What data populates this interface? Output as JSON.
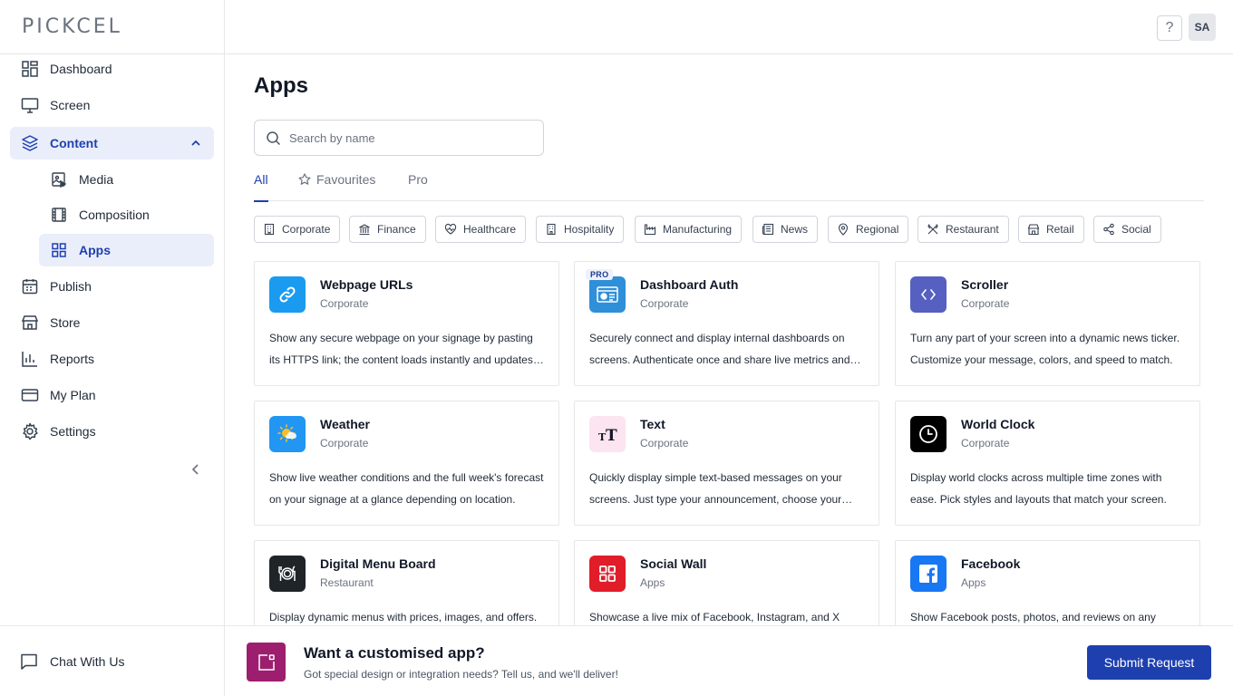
{
  "brand": {
    "logo_text": "PICKCEL"
  },
  "sidebar": {
    "items": [
      {
        "label": "Dashboard",
        "icon": "dashboard-icon"
      },
      {
        "label": "Screen",
        "icon": "monitor-icon"
      },
      {
        "label": "Content",
        "icon": "layers-icon",
        "expanded": true,
        "active": true
      },
      {
        "label": "Media",
        "icon": "image-icon",
        "sub": true
      },
      {
        "label": "Composition",
        "icon": "film-icon",
        "sub": true
      },
      {
        "label": "Apps",
        "icon": "grid-icon",
        "sub": true,
        "active": true
      },
      {
        "label": "Publish",
        "icon": "calendar-icon"
      },
      {
        "label": "Store",
        "icon": "store-icon"
      },
      {
        "label": "Reports",
        "icon": "bar-chart-icon"
      },
      {
        "label": "My Plan",
        "icon": "credit-card-icon"
      },
      {
        "label": "Settings",
        "icon": "gear-icon"
      }
    ],
    "chat_label": "Chat With Us"
  },
  "header": {
    "help_label": "?",
    "avatar_initials": "SA"
  },
  "main": {
    "title": "Apps",
    "search": {
      "placeholder": "Search by name",
      "value": ""
    },
    "tabs": [
      {
        "label": "All",
        "active": true
      },
      {
        "label": "Favourites",
        "icon": "star-icon"
      },
      {
        "label": "Pro"
      }
    ],
    "categories": [
      "Corporate",
      "Finance",
      "Healthcare",
      "Hospitality",
      "Manufacturing",
      "News",
      "Regional",
      "Restaurant",
      "Retail",
      "Social"
    ],
    "apps": [
      {
        "name": "Webpage URLs",
        "category": "Corporate",
        "description": "Show any secure webpage on your signage by pasting its HTTPS link; the content loads instantly and updates automatically.",
        "icon": "link-icon",
        "color": "#1a9bf0"
      },
      {
        "name": "Dashboard Auth",
        "category": "Corporate",
        "description": "Securely connect and display internal dashboards on screens. Authenticate once and share live metrics and reports.",
        "icon": "dashboard-auth-icon",
        "color": "#2f8fd8",
        "badge": "PRO"
      },
      {
        "name": "Scroller",
        "category": "Corporate",
        "description": "Turn any part of your screen into a dynamic news ticker. Customize your message, colors, and speed to match.",
        "icon": "code-brackets-icon",
        "color": "#5560c0"
      },
      {
        "name": "Weather",
        "category": "Corporate",
        "description": "Show live weather conditions and the full week's forecast on your signage at a glance depending on location.",
        "icon": "sun-cloud-icon",
        "color": "#2196f3"
      },
      {
        "name": "Text",
        "category": "Corporate",
        "description": "Quickly display simple text-based messages on your screens. Just type your announcement, choose your style.",
        "icon": "text-size-icon",
        "color": "#fce4f1"
      },
      {
        "name": "World Clock",
        "category": "Corporate",
        "description": "Display world clocks across multiple time zones with ease. Pick styles and layouts that match your screen.",
        "icon": "clock-icon",
        "color": "#000000"
      },
      {
        "name": "Digital Menu Board",
        "category": "Restaurant",
        "description": "Display dynamic menus with prices, images, and offers.",
        "icon": "plate-cutlery-icon",
        "color": "#1f2429"
      },
      {
        "name": "Social Wall",
        "category": "Apps",
        "description": "Showcase a live mix of Facebook, Instagram, and X posts.",
        "icon": "grid-apps-icon",
        "color": "#e11d2a"
      },
      {
        "name": "Facebook",
        "category": "Apps",
        "description": "Show Facebook posts, photos, and reviews on any screen.",
        "icon": "facebook-icon",
        "color": "#1877f2"
      }
    ]
  },
  "banner": {
    "title": "Want a customised app?",
    "subtitle": "Got special design or integration needs? Tell us, and we'll deliver!",
    "button_label": "Submit Request",
    "icon": "external-square-icon"
  }
}
